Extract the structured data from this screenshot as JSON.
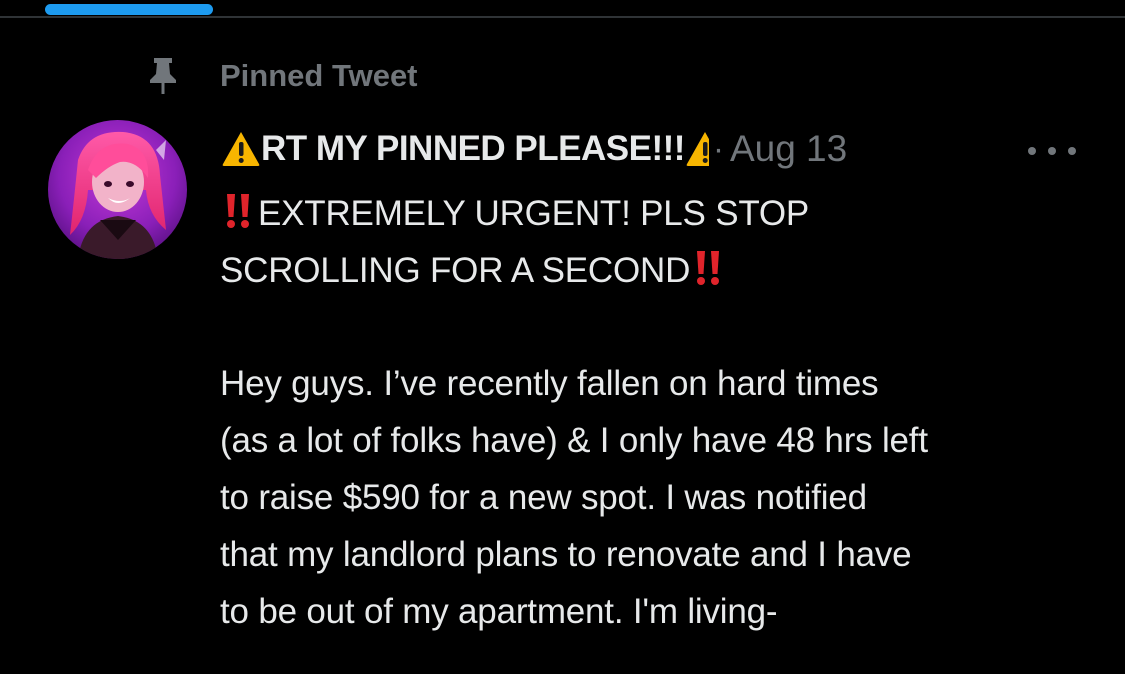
{
  "colors": {
    "background": "#000000",
    "text_primary": "#e7e9ea",
    "text_secondary": "#71767b",
    "accent": "#1d9bf0",
    "divider": "#2f3336"
  },
  "pinned": {
    "icon": "pin-icon",
    "label": "Pinned Tweet"
  },
  "tweet": {
    "avatar_icon": "avatar",
    "display_name": "RT MY PINNED PLEASE!!!",
    "separator": "·",
    "date": "Aug 13",
    "more_icon": "more-icon",
    "lines": {
      "l1": "EXTREMELY URGENT! PLS STOP",
      "l2": "SCROLLING FOR A SECOND",
      "l3": "Hey guys. I’ve recently fallen on hard times",
      "l4": "(as a lot of folks have) & I only have 48 hrs left",
      "l5": "to raise $590 for a new spot. I was notified",
      "l6": "that my landlord plans to renovate and I have",
      "l7": "to be out of my apartment. I'm living-"
    }
  }
}
